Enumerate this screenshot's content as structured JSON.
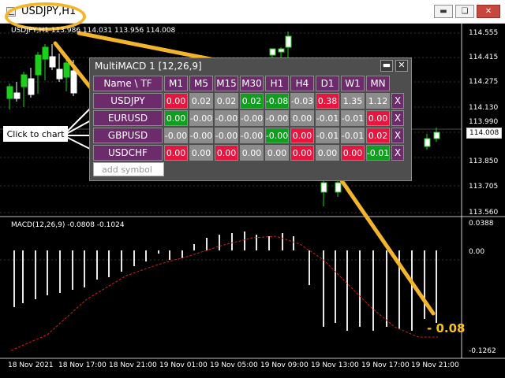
{
  "window": {
    "title": "USDJPY,H1"
  },
  "chart": {
    "symbol_info": "USDJPY,H1  113.986 114.031 113.956 114.008",
    "price_scale": [
      "114.555",
      "114.415",
      "114.275",
      "114.130",
      "113.990",
      "113.850",
      "113.705",
      "113.560"
    ],
    "current_price": "114.008",
    "macd_label": "MACD(12,26,9) -0.0808 -0.1024",
    "macd_scale": [
      "0.0388",
      "0.00",
      "-0.1262"
    ],
    "time_labels": [
      "18 Nov 2021",
      "18 Nov 17:00",
      "18 Nov 21:00",
      "19 Nov 01:00",
      "19 Nov 05:00",
      "19 Nov 09:00",
      "19 Nov 13:00",
      "19 Nov 17:00",
      "19 Nov 21:00"
    ],
    "colors": {
      "bull": "#1ccf1c",
      "bear": "#ffffff",
      "signal": "#d02020"
    }
  },
  "panel": {
    "title": "MultiMACD 1 [12,26,9]",
    "min_icon": "minimize-icon",
    "close_icon": "close-icon",
    "corner_label": "Name \\ TF",
    "timeframes": [
      "M1",
      "M5",
      "M15",
      "M30",
      "H1",
      "H4",
      "D1",
      "W1",
      "MN"
    ],
    "rows": [
      {
        "symbol": "USDJPY",
        "cells": [
          {
            "v": "0.00",
            "c": "red"
          },
          {
            "v": "0.02",
            "c": "grey"
          },
          {
            "v": "0.02",
            "c": "grey"
          },
          {
            "v": "0.02",
            "c": "green"
          },
          {
            "v": "-0.08",
            "c": "green"
          },
          {
            "v": "-0.03",
            "c": "grey"
          },
          {
            "v": "0.38",
            "c": "red"
          },
          {
            "v": "1.35",
            "c": "grey"
          },
          {
            "v": "1.12",
            "c": "grey"
          }
        ]
      },
      {
        "symbol": "EURUSD",
        "cells": [
          {
            "v": "0.00",
            "c": "green"
          },
          {
            "v": "-0.00",
            "c": "grey"
          },
          {
            "v": "-0.00",
            "c": "grey"
          },
          {
            "v": "-0.00",
            "c": "grey"
          },
          {
            "v": "-0.00",
            "c": "grey"
          },
          {
            "v": "0.00",
            "c": "grey"
          },
          {
            "v": "-0.01",
            "c": "grey"
          },
          {
            "v": "-0.01",
            "c": "grey"
          },
          {
            "v": "0.00",
            "c": "red"
          }
        ]
      },
      {
        "symbol": "GBPUSD",
        "cells": [
          {
            "v": "-0.00",
            "c": "grey"
          },
          {
            "v": "-0.00",
            "c": "grey"
          },
          {
            "v": "-0.00",
            "c": "grey"
          },
          {
            "v": "-0.00",
            "c": "grey"
          },
          {
            "v": "-0.00",
            "c": "green"
          },
          {
            "v": "0.00",
            "c": "red"
          },
          {
            "v": "-0.01",
            "c": "grey"
          },
          {
            "v": "-0.01",
            "c": "grey"
          },
          {
            "v": "0.02",
            "c": "red"
          }
        ]
      },
      {
        "symbol": "USDCHF",
        "cells": [
          {
            "v": "0.00",
            "c": "red"
          },
          {
            "v": "0.00",
            "c": "grey"
          },
          {
            "v": "0.00",
            "c": "red"
          },
          {
            "v": "0.00",
            "c": "grey"
          },
          {
            "v": "0.00",
            "c": "grey"
          },
          {
            "v": "0.00",
            "c": "red"
          },
          {
            "v": "0.00",
            "c": "grey"
          },
          {
            "v": "0.00",
            "c": "red"
          },
          {
            "v": "-0.01",
            "c": "green"
          }
        ]
      }
    ],
    "remove_label": "X",
    "add_placeholder": "add symbol"
  },
  "annotations": {
    "click_to_chart": "Click to chart",
    "highlight_value": "- 0.08",
    "highlight_color": "#f5b52a"
  }
}
